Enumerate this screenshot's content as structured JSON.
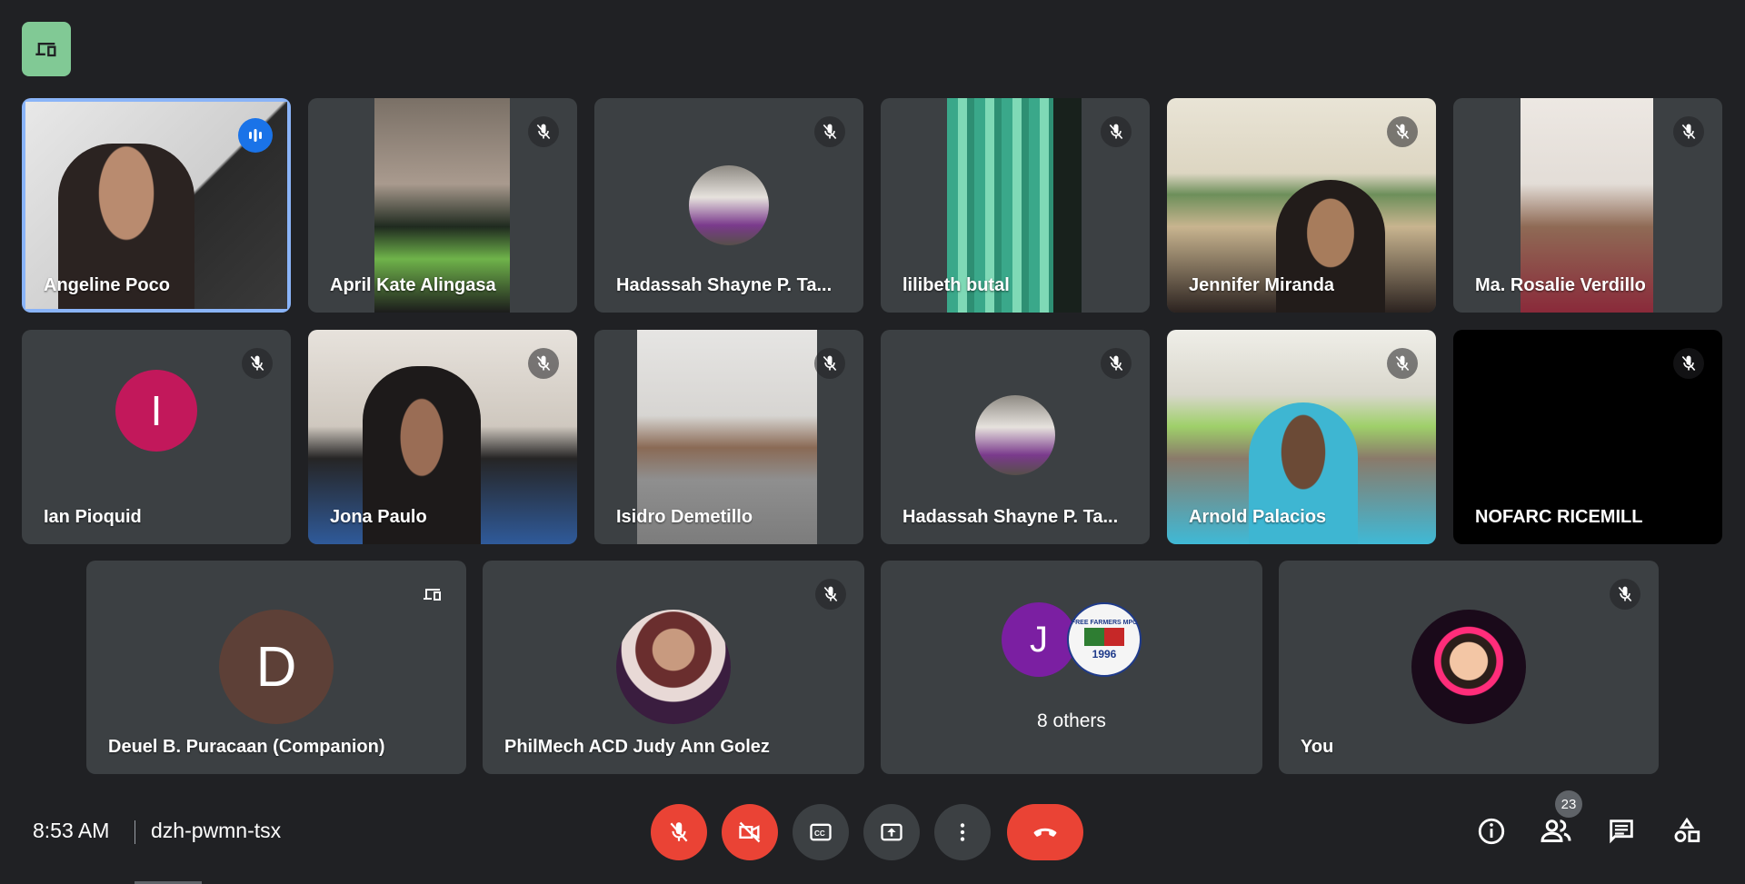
{
  "participants": [
    {
      "name": "Angeline Poco"
    },
    {
      "name": "April Kate Alingasa"
    },
    {
      "name": "Hadassah Shayne P. Ta..."
    },
    {
      "name": "lilibeth butal"
    },
    {
      "name": "Jennifer Miranda"
    },
    {
      "name": "Ma. Rosalie Verdillo"
    },
    {
      "name": "Ian Pioquid",
      "initial": "I"
    },
    {
      "name": "Jona Paulo"
    },
    {
      "name": "Isidro Demetillo"
    },
    {
      "name": "Hadassah Shayne P. Ta..."
    },
    {
      "name": "Arnold Palacios"
    },
    {
      "name": "NOFARC RICEMILL"
    },
    {
      "name": "Deuel B. Puracaan (Companion)",
      "initial": "D"
    },
    {
      "name": "PhilMech ACD Judy Ann Golez"
    },
    {
      "name": "8 others",
      "initial": "J",
      "logo_text": "FREE FARMERS MPC",
      "logo_year": "1996"
    },
    {
      "name": "You"
    }
  ],
  "bottom_bar": {
    "time": "8:53 AM",
    "meeting_code": "dzh-pwmn-tsx",
    "participant_count": "23"
  },
  "colors": {
    "background": "#202124",
    "tile": "#3c4043",
    "accent_blue": "#1a73e8",
    "active_border": "#8ab4f8",
    "danger_red": "#ea4335",
    "companion_badge": "#81c995"
  },
  "icons": [
    "companion-mode-icon",
    "mic-off-icon",
    "speaking-indicator-icon",
    "camera-off-icon",
    "captions-icon",
    "present-icon",
    "more-options-icon",
    "leave-call-icon",
    "info-icon",
    "people-icon",
    "chat-icon",
    "activities-icon"
  ]
}
